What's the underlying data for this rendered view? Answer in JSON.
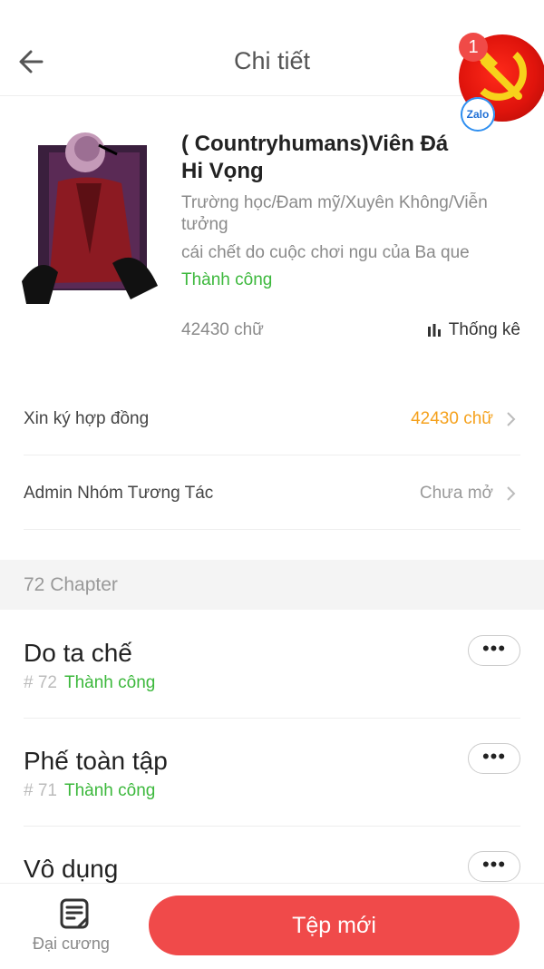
{
  "header": {
    "title": "Chi tiết",
    "notification_count": "1",
    "zalo_label": "Zalo"
  },
  "story": {
    "title": "( Countryhumans)Viên Đá Hi Vọng",
    "genres": "Trường học/Đam mỹ/Xuyên Không/Viễn tưởng",
    "description": "cái chết do cuộc chơi ngu của Ba que",
    "status": "Thành công",
    "word_count": "42430 chữ",
    "stats_label": "Thống kê"
  },
  "rows": [
    {
      "label": "Xin ký hợp đồng",
      "value": "42430 chữ",
      "value_color": "#f5a11c"
    },
    {
      "label": "Admin Nhóm Tương Tác",
      "value": "Chưa mở",
      "value_color": "#9a9a9a"
    }
  ],
  "chapters_header": "72 Chapter",
  "chapters": [
    {
      "title": "Do ta chế",
      "number": "# 72",
      "status": "Thành công"
    },
    {
      "title": "Phế toàn tập",
      "number": "# 71",
      "status": "Thành công"
    },
    {
      "title": "Vô dụng",
      "number": "",
      "status": ""
    }
  ],
  "more_label": "•••",
  "bottom": {
    "outline_label": "Đại cương",
    "new_button": "Tệp mới"
  },
  "colors": {
    "accent": "#f04a4a",
    "success": "#3cb83c",
    "highlight": "#f5a11c"
  }
}
